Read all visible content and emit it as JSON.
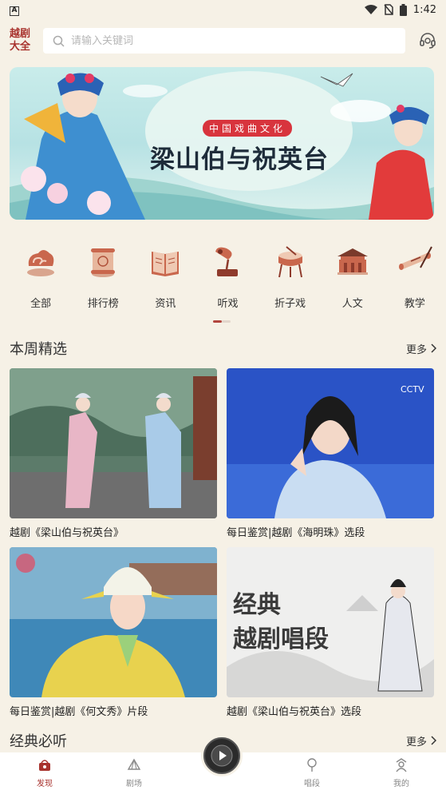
{
  "status_bar": {
    "left_icon_letter": "A",
    "time": "1:42"
  },
  "header": {
    "logo_line1": "越剧",
    "logo_line2": "大全",
    "search_placeholder": "请输入关键词",
    "search_icon": "search-icon",
    "service_icon": "headset-icon"
  },
  "banner": {
    "tag": "中国戏曲文化",
    "title": "梁山伯与祝英台"
  },
  "categories": [
    {
      "label": "全部",
      "icon": "cloud-pattern-icon"
    },
    {
      "label": "排行榜",
      "icon": "scroll-icon"
    },
    {
      "label": "资讯",
      "icon": "book-icon"
    },
    {
      "label": "听戏",
      "icon": "gramophone-icon"
    },
    {
      "label": "折子戏",
      "icon": "drum-icon"
    },
    {
      "label": "人文",
      "icon": "palace-icon"
    },
    {
      "label": "教学",
      "icon": "brush-scroll-icon"
    }
  ],
  "weekly": {
    "title": "本周精选",
    "more": "更多",
    "items": [
      {
        "title": "越剧《梁山伯与祝英台》"
      },
      {
        "title": "每日鉴赏|越剧《海明珠》选段",
        "watermark": "CCTV"
      },
      {
        "title": "每日鉴赏|越剧《何文秀》片段"
      },
      {
        "title": "越剧《梁山伯与祝英台》选段",
        "calligraphy_line1": "经典",
        "calligraphy_line2": "越剧唱段"
      }
    ]
  },
  "classic": {
    "title": "经典必听",
    "more": "更多"
  },
  "nav": {
    "items": [
      {
        "label": "发现",
        "icon": "discover-icon"
      },
      {
        "label": "剧场",
        "icon": "theater-icon"
      },
      {
        "label": "唱段",
        "icon": "aria-icon"
      },
      {
        "label": "我的",
        "icon": "profile-icon"
      }
    ]
  },
  "colors": {
    "accent": "#a8322d",
    "background": "#f6f1e6",
    "tag_red": "#d8343d"
  }
}
